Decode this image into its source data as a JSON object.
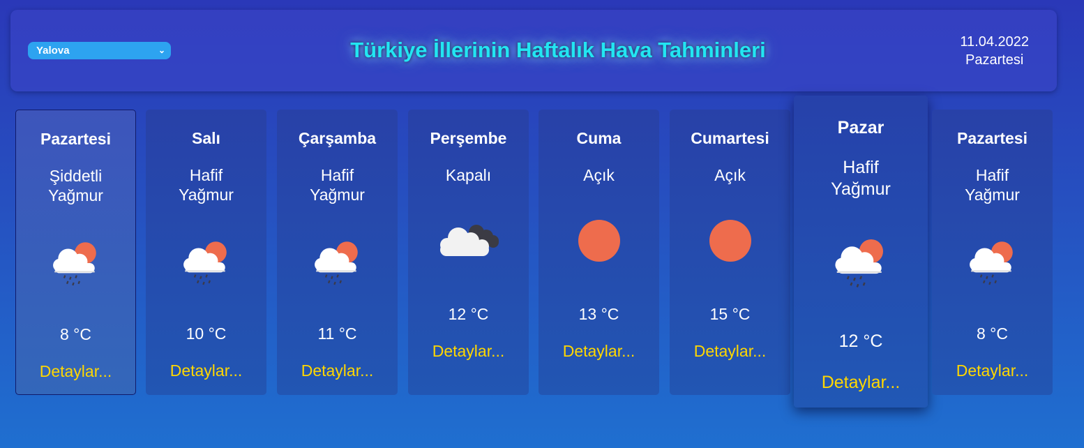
{
  "header": {
    "city": "Yalova",
    "title": "Türkiye İllerinin Haftalık Hava Tahminleri",
    "date": "11.04.2022",
    "weekday": "Pazartesi"
  },
  "forecast": [
    {
      "day": "Pazartesi",
      "cond_line1": "Şiddetli",
      "cond_line2": "Yağmur",
      "temp": "8 °C",
      "details": "Detaylar...",
      "icon": "rain-cloud-sun-icon"
    },
    {
      "day": "Salı",
      "cond_line1": "Hafif",
      "cond_line2": "Yağmur",
      "temp": "10 °C",
      "details": "Detaylar...",
      "icon": "rain-cloud-sun-icon"
    },
    {
      "day": "Çarşamba",
      "cond_line1": "Hafif",
      "cond_line2": "Yağmur",
      "temp": "11 °C",
      "details": "Detaylar...",
      "icon": "rain-cloud-sun-icon"
    },
    {
      "day": "Perşembe",
      "cond_line1": "Kapalı",
      "cond_line2": "",
      "temp": "12 °C",
      "details": "Detaylar...",
      "icon": "overcast-cloud-icon"
    },
    {
      "day": "Cuma",
      "cond_line1": "Açık",
      "cond_line2": "",
      "temp": "13 °C",
      "details": "Detaylar...",
      "icon": "sun-icon"
    },
    {
      "day": "Cumartesi",
      "cond_line1": "Açık",
      "cond_line2": "",
      "temp": "15 °C",
      "details": "Detaylar...",
      "icon": "sun-icon"
    },
    {
      "day": "Pazar",
      "cond_line1": "Hafif",
      "cond_line2": "Yağmur",
      "temp": "12 °C",
      "details": "Detaylar...",
      "icon": "rain-cloud-sun-icon"
    },
    {
      "day": "Pazartesi",
      "cond_line1": "Hafif",
      "cond_line2": "Yağmur",
      "temp": "8 °C",
      "details": "Detaylar...",
      "icon": "rain-cloud-sun-icon"
    }
  ],
  "colors": {
    "title": "#22e6f2",
    "details_link": "#ffd700",
    "sun": "#ee6c4d",
    "select": "#2da3f0"
  }
}
